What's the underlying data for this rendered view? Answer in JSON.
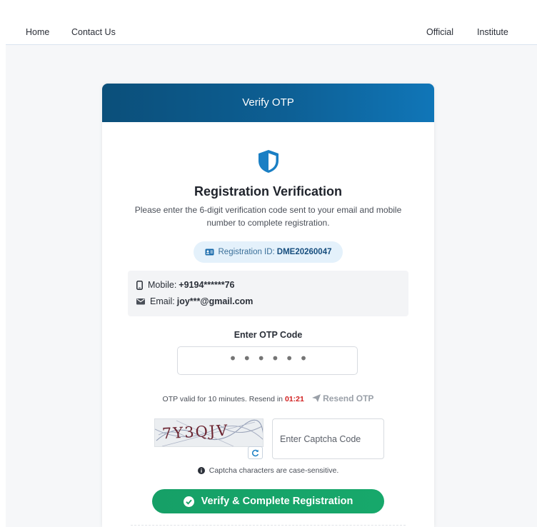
{
  "nav": {
    "left": [
      "Home",
      "Contact Us"
    ],
    "right": [
      "Official",
      "Institute"
    ]
  },
  "card": {
    "header_title": "Verify OTP",
    "title": "Registration Verification",
    "description": "Please enter the 6-digit verification code sent to your email and mobile number to complete registration.",
    "registration_id_label": "Registration ID:",
    "registration_id_value": "DME20260047",
    "mobile_label": "Mobile:",
    "mobile_value": "+9194******76",
    "email_label": "Email:",
    "email_value": "joy***@gmail.com",
    "otp_label": "Enter OTP Code",
    "otp_placeholder": "••••••",
    "otp_info_prefix": "OTP valid for 10 minutes. Resend in",
    "otp_timer": "01:21",
    "resend_label": "Resend OTP",
    "captcha_text": "7Y3QJV",
    "captcha_placeholder": "Enter Captcha Code",
    "captcha_note": "Captcha characters are case-sensitive.",
    "verify_button": "Verify & Complete Registration"
  },
  "colors": {
    "header_gradient_start": "#0b4f7a",
    "header_gradient_end": "#1076b8",
    "accent_blue": "#1a7fc4",
    "timer_red": "#d11f1f",
    "button_green": "#16a067"
  },
  "icons": {
    "shield": "shield-icon",
    "id_card": "id-card-icon",
    "mobile": "mobile-phone-icon",
    "email": "envelope-icon",
    "send": "paper-plane-icon",
    "refresh": "refresh-icon",
    "info": "info-circle-icon",
    "check": "check-circle-icon"
  }
}
